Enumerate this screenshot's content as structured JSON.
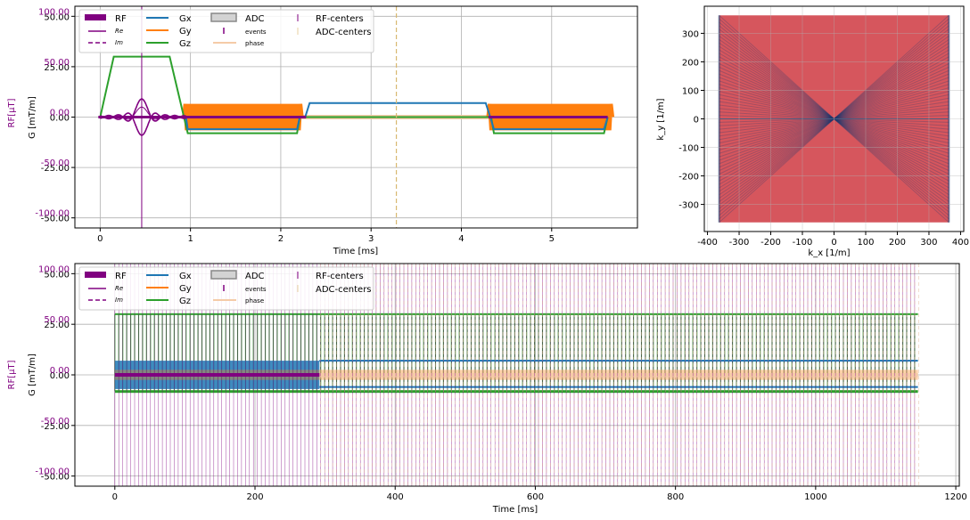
{
  "colors": {
    "rf": "#800080",
    "gx": "#1f77b4",
    "gy": "#ff7f0e",
    "gz": "#2ca02c",
    "adc_phase": "#f5cba7",
    "adc_fill": "#d3d3d3",
    "k_traj": "#1f3a6e",
    "k_adc": "#d2444b",
    "grid": "#b0b0b0"
  },
  "legend": {
    "rf": "RF",
    "re": "Re",
    "im": "Im",
    "gx": "Gx",
    "gy": "Gy",
    "gz": "Gz",
    "adc": "ADC",
    "events": "events",
    "phase": "phase",
    "rf_centers": "RF-centers",
    "adc_centers": "ADC-centers"
  },
  "chart_data": [
    {
      "type": "line",
      "panel": "sequence-zoom",
      "xlabel": "Time [ms]",
      "ylabel_g": "G [mT/m]",
      "ylabel_rf": "RF[μT]",
      "xlim": [
        -0.28,
        5.95
      ],
      "xticks": [
        0,
        1,
        2,
        3,
        4,
        5
      ],
      "rf_ylim": [
        -110,
        110
      ],
      "rf_ticks": [
        -100,
        -50,
        0,
        50,
        100
      ],
      "g_ylim": [
        -55,
        55
      ],
      "g_ticks": [
        -50,
        -25,
        0,
        25,
        50
      ],
      "tick_labels_rf": [
        "-100.00",
        "-50.00",
        "0.00",
        "50.00",
        "100.00"
      ],
      "tick_labels_g": [
        "-50.00",
        "-25.00",
        "0.00",
        "25.00",
        "50.00"
      ],
      "grid": true,
      "legend_position": "top-left",
      "rf_center_ms": 0.46,
      "adc_center_ms": 3.28,
      "rf_pulse": {
        "start": 0.0,
        "end": 0.95,
        "center": 0.46,
        "peak_uT": 18
      },
      "series": [
        {
          "name": "Gz",
          "points": [
            [
              0.0,
              0
            ],
            [
              0.15,
              30
            ],
            [
              0.77,
              30
            ],
            [
              0.97,
              -8
            ],
            [
              2.18,
              -8
            ],
            [
              2.21,
              0
            ],
            [
              4.33,
              0
            ],
            [
              4.36,
              -8
            ],
            [
              5.58,
              -8
            ],
            [
              5.62,
              0
            ]
          ]
        },
        {
          "name": "Gx",
          "points": [
            [
              0.95,
              0
            ],
            [
              0.97,
              -6
            ],
            [
              2.18,
              -6
            ],
            [
              2.21,
              0
            ],
            [
              2.27,
              0
            ],
            [
              2.32,
              7
            ],
            [
              4.27,
              7
            ],
            [
              4.32,
              0
            ],
            [
              4.36,
              -6
            ],
            [
              5.58,
              -6
            ],
            [
              5.62,
              0
            ]
          ]
        },
        {
          "name": "Gy",
          "bands": [
            [
              0.93,
              2.23
            ],
            [
              4.3,
              5.67
            ]
          ],
          "amplitude": 6.5,
          "cycles": 40
        }
      ],
      "adc_phase_band": [
        2.23,
        4.3
      ]
    },
    {
      "type": "scatter",
      "panel": "k-space",
      "xlabel": "k_x [1/m]",
      "ylabel": "k_y [1/m]",
      "xlim": [
        -410,
        410
      ],
      "ylim": [
        -395,
        395
      ],
      "xticks": [
        -400,
        -300,
        -200,
        -100,
        0,
        100,
        200,
        300,
        400
      ],
      "yticks": [
        -300,
        -200,
        -100,
        0,
        100,
        200,
        300
      ],
      "kmax": 363,
      "grid": true
    },
    {
      "type": "line",
      "panel": "sequence-full",
      "xlabel": "Time [ms]",
      "ylabel_g": "G [mT/m]",
      "ylabel_rf": "RF[μT]",
      "xlim": [
        -57,
        1205
      ],
      "xticks": [
        0,
        200,
        400,
        600,
        800,
        1000,
        1200
      ],
      "rf_ylim": [
        -110,
        110
      ],
      "g_ylim": [
        -55,
        55
      ],
      "grid": true,
      "legend_position": "top-left",
      "prep_end_ms": 292,
      "seq_end_ms": 1146,
      "tr_ms": 5.65,
      "gz_peak": 30
    }
  ]
}
